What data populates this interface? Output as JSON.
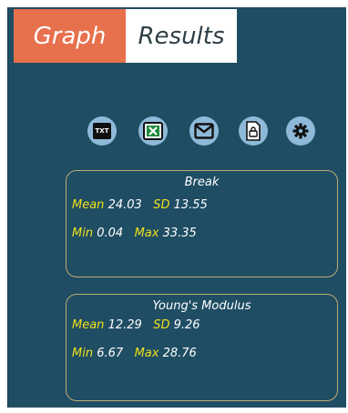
{
  "tabs": {
    "graph": "Graph",
    "results": "Results"
  },
  "toolbar": {
    "txt_label": "TXT",
    "icons": [
      "txt-export-icon",
      "excel-export-icon",
      "email-icon",
      "save-icon",
      "settings-gear-icon"
    ]
  },
  "colors": {
    "panel": "#1f4d63",
    "active_tab": "#e7704d",
    "label_yellow": "#f0e11c",
    "box_border": "#bfa974"
  },
  "stats": {
    "break": {
      "title": "Break",
      "mean_label": "Mean",
      "mean": "24.03",
      "sd_label": "SD",
      "sd": "13.55",
      "min_label": "Min",
      "min": "0.04",
      "max_label": "Max",
      "max": "33.35"
    },
    "youngs": {
      "title": "Young's Modulus",
      "mean_label": "Mean",
      "mean": "12.29",
      "sd_label": "SD",
      "sd": "9.26",
      "min_label": "Min",
      "min": "6.67",
      "max_label": "Max",
      "max": "28.76"
    }
  }
}
